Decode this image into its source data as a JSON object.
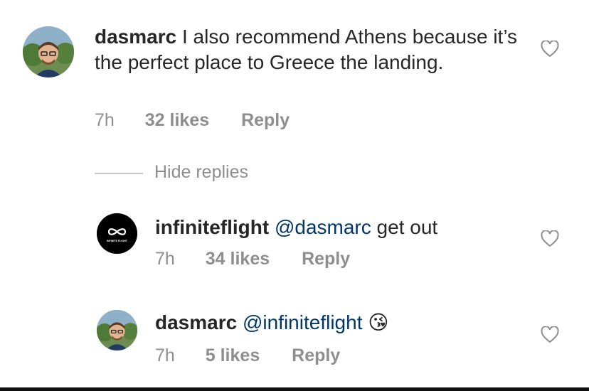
{
  "comments": [
    {
      "username": "dasmarc",
      "text": " I also recommend Athens because it’s the perfect place to Greece the landing.",
      "time": "7h",
      "likes": "32 likes",
      "reply": "Reply",
      "avatar_icon": "user-photo-avatar",
      "heart_icon": "heart-outline-icon"
    },
    {
      "username": "infiniteflight",
      "mention": "@dasmarc",
      "text": " get out",
      "time": "7h",
      "likes": "34 likes",
      "reply": "Reply",
      "avatar_icon": "infinite-flight-logo",
      "logo_caption": "INFINITE FLIGHT",
      "heart_icon": "heart-outline-icon"
    },
    {
      "username": "dasmarc",
      "mention": "@infiniteflight",
      "emoji": "😘",
      "time": "7h",
      "likes": "5 likes",
      "reply": "Reply",
      "avatar_icon": "user-photo-avatar",
      "heart_icon": "heart-outline-icon"
    }
  ],
  "hide_replies": "Hide replies",
  "colors": {
    "text": "#262626",
    "muted": "#8e8e8e",
    "mention": "#00376b",
    "background": "#ffffff"
  }
}
